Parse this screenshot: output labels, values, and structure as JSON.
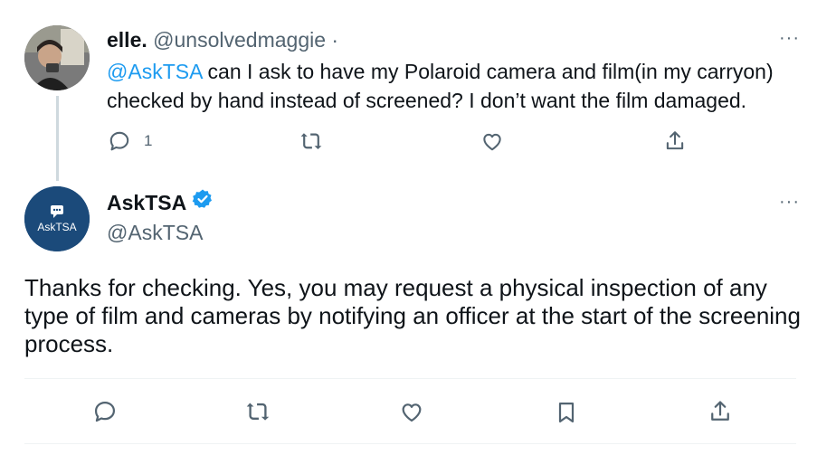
{
  "tweet1": {
    "author_name": "elle.",
    "author_handle": "@unsolvedmaggie",
    "separator": "·",
    "mention": "@AskTSA",
    "text": " can I ask to have my Polaroid camera and film(in my carryon) checked by hand instead of screened? I don’t want the film damaged.",
    "reply_count": "1",
    "more_label": "···"
  },
  "tweet2": {
    "avatar_label": "AskTSA",
    "author_name": "AskTSA",
    "author_handle": "@AskTSA",
    "text": "Thanks for checking. Yes, you may request a physical inspection of any type of film and cameras by notifying an officer at the start of the screening process.",
    "more_label": "···"
  },
  "icons": {
    "reply": "reply-icon",
    "retweet": "retweet-icon",
    "like": "heart-icon",
    "bookmark": "bookmark-icon",
    "share": "share-icon",
    "verified": "verified-badge-icon"
  },
  "colors": {
    "accent": "#1d9bf0",
    "secondary_text": "#536471",
    "tsa_avatar": "#1b4a7a"
  }
}
